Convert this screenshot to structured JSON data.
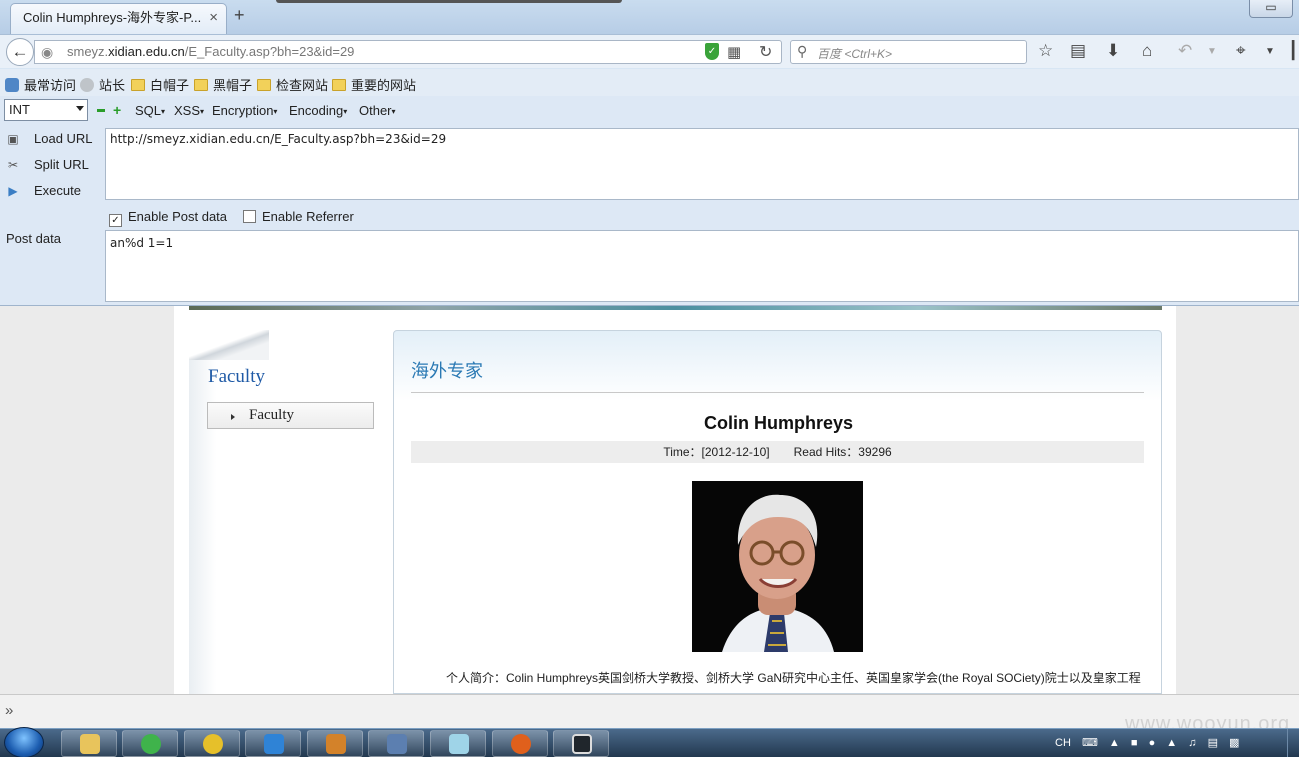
{
  "tab": {
    "title": "Colin Humphreys-海外专家-P...",
    "close": "×",
    "new": "+"
  },
  "window": {
    "control": "▭"
  },
  "nav": {
    "url_host": "smeyz.xidian.edu.cn",
    "url_path": "/E_Faculty.asp?bh=23&id=29",
    "url_prefix": "smeyz.",
    "url_domain": "xidian.edu.cn",
    "search_placeholder": "百度 <Ctrl+K>"
  },
  "bookmarks": [
    "最常访问",
    "站长",
    "白帽子",
    "黑帽子",
    "检查网站",
    "重要的网站"
  ],
  "hackbar": {
    "type_select": "INT",
    "menus": [
      "SQL",
      "XSS",
      "Encryption",
      "Encoding",
      "Other"
    ],
    "actions": [
      "Load URL",
      "Split URL",
      "Execute"
    ],
    "url_value": "http://smeyz.xidian.edu.cn/E_Faculty.asp?bh=23&id=29",
    "enable_post": "Enable Post data",
    "enable_referrer": "Enable Referrer",
    "post_label": "Post data",
    "post_value": "an%d 1=1"
  },
  "page": {
    "sidebar_title": "Faculty",
    "sidebar_item": "Faculty",
    "section_title": "海外专家",
    "article_title": "Colin Humphreys",
    "time_text": "Time：[2012-12-10]",
    "hits_text": "Read Hits：39296",
    "paragraph": "个人简介：Colin Humphreys英国剑桥大学教授、剑桥大学 GaN研究中心主任、英国皇家学会(the Royal SOCiety)院士以及皇家工程"
  },
  "status": {
    "watermark": "www.wooyun.org"
  },
  "tray": {
    "lang": "CH"
  },
  "colors": {
    "accent": "#2a79b4",
    "link_blue": "#1f5aa6",
    "post_checked": true,
    "referrer_checked": false
  }
}
